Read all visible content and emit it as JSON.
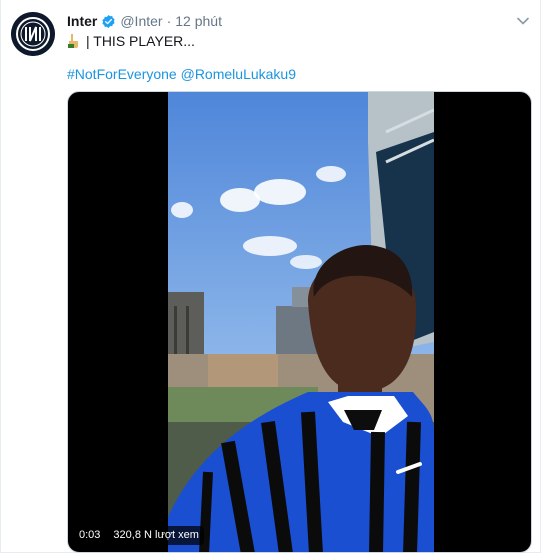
{
  "tweet": {
    "author_name": "Inter",
    "author_handle": "@Inter",
    "separator": "·",
    "timestamp": "12 phút",
    "text": "| THIS PLAYER...",
    "emoji_icon": "pointing-hand-emoji",
    "hashtag": "#NotForEveryone",
    "mention": "@RomeluLukaku9"
  },
  "video": {
    "elapsed": "0:03",
    "views": "320,8 N lượt xem"
  },
  "colors": {
    "link": "#1b95e0",
    "verified": "#1da1f2",
    "secondary_text": "#657786",
    "jersey_blue": "#1a4fd1"
  }
}
